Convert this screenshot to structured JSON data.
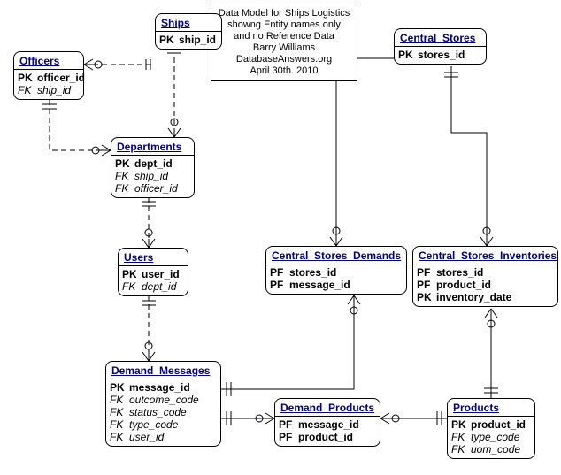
{
  "note": {
    "l1": "Data Model for Ships Logistics",
    "l2": "showng Entity names only",
    "l3": "and no Reference Data",
    "l4": "Barry Williams",
    "l5": "DatabaseAnswers.org",
    "l6": "April 30th. 2010"
  },
  "entities": {
    "officers": {
      "title": "Officers",
      "cols": [
        {
          "kt": "PK",
          "nm": "officer_id",
          "c": "pk"
        },
        {
          "kt": "FK",
          "nm": "ship_id",
          "c": "fk"
        }
      ]
    },
    "ships": {
      "title": "Ships",
      "cols": [
        {
          "kt": "PK",
          "nm": "ship_id",
          "c": "pk"
        }
      ]
    },
    "departments": {
      "title": "Departments",
      "cols": [
        {
          "kt": "PK",
          "nm": "dept_id",
          "c": "pk"
        },
        {
          "kt": "FK",
          "nm": "ship_id",
          "c": "fk"
        },
        {
          "kt": "FK",
          "nm": "officer_id",
          "c": "fk"
        }
      ]
    },
    "users": {
      "title": "Users",
      "cols": [
        {
          "kt": "PK",
          "nm": "user_id",
          "c": "pk"
        },
        {
          "kt": "FK",
          "nm": "dept_id",
          "c": "fk"
        }
      ]
    },
    "central_stores": {
      "title": "Central_Stores",
      "cols": [
        {
          "kt": "PK",
          "nm": "stores_id",
          "c": "pk"
        }
      ]
    },
    "csd": {
      "title": "Central_Stores_Demands",
      "cols": [
        {
          "kt": "PF",
          "nm": "stores_id",
          "c": "pk"
        },
        {
          "kt": "PF",
          "nm": "message_id",
          "c": "pk"
        }
      ]
    },
    "csi": {
      "title": "Central_Stores_Inventories",
      "cols": [
        {
          "kt": "PF",
          "nm": "stores_id",
          "c": "pk"
        },
        {
          "kt": "PF",
          "nm": "product_id",
          "c": "pk"
        },
        {
          "kt": "PK",
          "nm": "inventory_date",
          "c": "pk"
        }
      ]
    },
    "demand_messages": {
      "title": "Demand_Messages",
      "cols": [
        {
          "kt": "PK",
          "nm": "message_id",
          "c": "pk"
        },
        {
          "kt": "FK",
          "nm": "outcome_code",
          "c": "fk"
        },
        {
          "kt": "FK",
          "nm": "status_code",
          "c": "fk"
        },
        {
          "kt": "FK",
          "nm": "type_code",
          "c": "fk"
        },
        {
          "kt": "FK",
          "nm": "user_id",
          "c": "fk"
        }
      ]
    },
    "demand_products": {
      "title": "Demand_Products",
      "cols": [
        {
          "kt": "PF",
          "nm": "message_id",
          "c": "pk"
        },
        {
          "kt": "PF",
          "nm": "product_id",
          "c": "pk"
        }
      ]
    },
    "products": {
      "title": "Products",
      "cols": [
        {
          "kt": "PK",
          "nm": "product_id",
          "c": "pk"
        },
        {
          "kt": "FK",
          "nm": "type_code",
          "c": "fk"
        },
        {
          "kt": "FK",
          "nm": "uom_code",
          "c": "fk"
        }
      ]
    }
  },
  "chart_data": {
    "type": "er-diagram",
    "title": "Data Model for Ships Logistics showng Entity names only and no Reference Data",
    "author": "Barry Williams",
    "source": "DatabaseAnswers.org",
    "date": "April 30th. 2010",
    "entities": [
      {
        "name": "Officers",
        "columns": [
          {
            "key": "PK",
            "name": "officer_id"
          },
          {
            "key": "FK",
            "name": "ship_id"
          }
        ]
      },
      {
        "name": "Ships",
        "columns": [
          {
            "key": "PK",
            "name": "ship_id"
          }
        ]
      },
      {
        "name": "Departments",
        "columns": [
          {
            "key": "PK",
            "name": "dept_id"
          },
          {
            "key": "FK",
            "name": "ship_id"
          },
          {
            "key": "FK",
            "name": "officer_id"
          }
        ]
      },
      {
        "name": "Users",
        "columns": [
          {
            "key": "PK",
            "name": "user_id"
          },
          {
            "key": "FK",
            "name": "dept_id"
          }
        ]
      },
      {
        "name": "Central_Stores",
        "columns": [
          {
            "key": "PK",
            "name": "stores_id"
          }
        ]
      },
      {
        "name": "Central_Stores_Demands",
        "columns": [
          {
            "key": "PF",
            "name": "stores_id"
          },
          {
            "key": "PF",
            "name": "message_id"
          }
        ]
      },
      {
        "name": "Central_Stores_Inventories",
        "columns": [
          {
            "key": "PF",
            "name": "stores_id"
          },
          {
            "key": "PF",
            "name": "product_id"
          },
          {
            "key": "PK",
            "name": "inventory_date"
          }
        ]
      },
      {
        "name": "Demand_Messages",
        "columns": [
          {
            "key": "PK",
            "name": "message_id"
          },
          {
            "key": "FK",
            "name": "outcome_code"
          },
          {
            "key": "FK",
            "name": "status_code"
          },
          {
            "key": "FK",
            "name": "type_code"
          },
          {
            "key": "FK",
            "name": "user_id"
          }
        ]
      },
      {
        "name": "Demand_Products",
        "columns": [
          {
            "key": "PF",
            "name": "message_id"
          },
          {
            "key": "PF",
            "name": "product_id"
          }
        ]
      },
      {
        "name": "Products",
        "columns": [
          {
            "key": "PK",
            "name": "product_id"
          },
          {
            "key": "FK",
            "name": "type_code"
          },
          {
            "key": "FK",
            "name": "uom_code"
          }
        ]
      }
    ],
    "relationships": [
      {
        "from": "Ships",
        "to": "Officers",
        "identifying": false
      },
      {
        "from": "Ships",
        "to": "Departments",
        "identifying": false
      },
      {
        "from": "Officers",
        "to": "Departments",
        "identifying": false
      },
      {
        "from": "Departments",
        "to": "Users",
        "identifying": false
      },
      {
        "from": "Users",
        "to": "Demand_Messages",
        "identifying": false
      },
      {
        "from": "Central_Stores",
        "to": "Central_Stores_Demands",
        "identifying": true
      },
      {
        "from": "Central_Stores",
        "to": "Central_Stores_Inventories",
        "identifying": true
      },
      {
        "from": "Demand_Messages",
        "to": "Central_Stores_Demands",
        "identifying": true
      },
      {
        "from": "Demand_Messages",
        "to": "Demand_Products",
        "identifying": true
      },
      {
        "from": "Products",
        "to": "Demand_Products",
        "identifying": true
      },
      {
        "from": "Products",
        "to": "Central_Stores_Inventories",
        "identifying": true
      }
    ]
  }
}
